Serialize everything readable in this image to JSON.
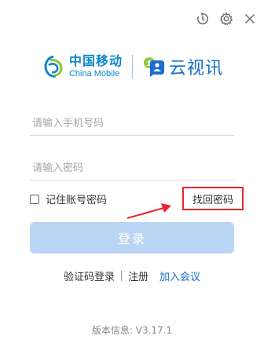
{
  "window": {
    "icons": [
      "history-icon",
      "gear-icon",
      "close-icon"
    ]
  },
  "logos": {
    "china_mobile_cn": "中国移动",
    "china_mobile_en": "China Mobile",
    "yunshixun": "云视讯"
  },
  "form": {
    "phone_placeholder": "请输入手机号码",
    "password_placeholder": "请输入密码",
    "remember_label": "记住账号密码",
    "remember_checked": false,
    "forgot_label": "找回密码",
    "login_label": "登录"
  },
  "links": {
    "sms_login": "验证码登录",
    "register": "注册",
    "join_meeting": "加入会议"
  },
  "footer": {
    "version": "版本信息: V3.17.1"
  },
  "colors": {
    "accent": "#1a6fc9",
    "china_mobile_blue": "#0a87c8",
    "login_disabled": "#b9d5f3",
    "highlight_red": "#e8252a"
  }
}
